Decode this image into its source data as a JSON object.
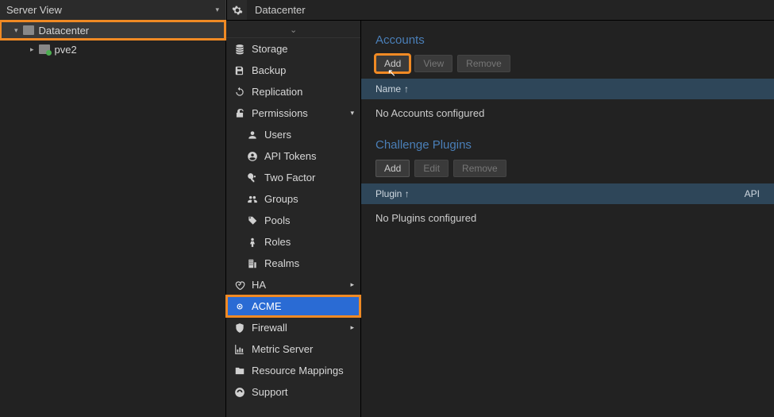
{
  "top": {
    "server_view_label": "Server View",
    "breadcrumb": "Datacenter"
  },
  "tree": {
    "datacenter_label": "Datacenter",
    "node_label": "pve2"
  },
  "nav": [
    {
      "id": "storage",
      "label": "Storage",
      "icon": "database",
      "sub": false
    },
    {
      "id": "backup",
      "label": "Backup",
      "icon": "save",
      "sub": false
    },
    {
      "id": "replication",
      "label": "Replication",
      "icon": "sync",
      "sub": false
    },
    {
      "id": "permissions",
      "label": "Permissions",
      "icon": "lock-open",
      "sub": false,
      "arrow": "down"
    },
    {
      "id": "users",
      "label": "Users",
      "icon": "user",
      "sub": true
    },
    {
      "id": "api-tokens",
      "label": "API Tokens",
      "icon": "user-circle",
      "sub": true
    },
    {
      "id": "two-factor",
      "label": "Two Factor",
      "icon": "key",
      "sub": true
    },
    {
      "id": "groups",
      "label": "Groups",
      "icon": "group",
      "sub": true
    },
    {
      "id": "pools",
      "label": "Pools",
      "icon": "tags",
      "sub": true
    },
    {
      "id": "roles",
      "label": "Roles",
      "icon": "male",
      "sub": true
    },
    {
      "id": "realms",
      "label": "Realms",
      "icon": "building",
      "sub": true
    },
    {
      "id": "ha",
      "label": "HA",
      "icon": "heart",
      "sub": false,
      "arrow": "right"
    },
    {
      "id": "acme",
      "label": "ACME",
      "icon": "cert",
      "sub": false,
      "selected": true,
      "highlight": true
    },
    {
      "id": "firewall",
      "label": "Firewall",
      "icon": "shield",
      "sub": false,
      "arrow": "right"
    },
    {
      "id": "metric",
      "label": "Metric Server",
      "icon": "chart",
      "sub": false
    },
    {
      "id": "resource-mappings",
      "label": "Resource Mappings",
      "icon": "folder",
      "sub": false
    },
    {
      "id": "support",
      "label": "Support",
      "icon": "support",
      "sub": false
    }
  ],
  "content": {
    "accounts": {
      "title": "Accounts",
      "add": "Add",
      "view": "View",
      "remove": "Remove",
      "col_name": "Name",
      "sort_arrow": "↑",
      "empty": "No Accounts configured"
    },
    "plugins": {
      "title": "Challenge Plugins",
      "add": "Add",
      "edit": "Edit",
      "remove": "Remove",
      "col_plugin": "Plugin",
      "sort_arrow": "↑",
      "col_api": "API",
      "empty": "No Plugins configured"
    }
  }
}
